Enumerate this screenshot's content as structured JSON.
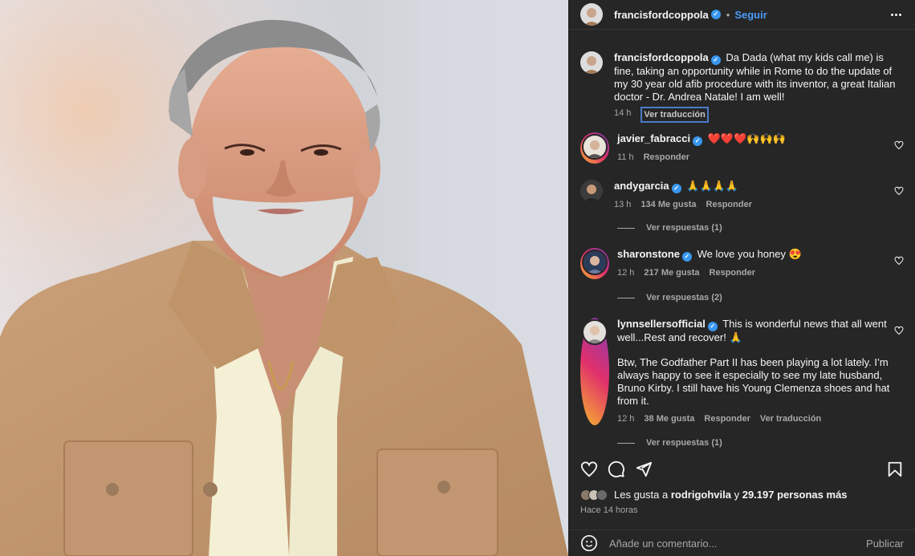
{
  "post": {
    "author": "francisfordcoppola",
    "follow_label": "Seguir",
    "dot": "•",
    "verified_mark": "✓",
    "caption": "Da Dada (what my kids call me) is fine, taking an opportunity while in Rome to do the update of my 30 year old afib procedure with its inventor, a great Italian doctor - Dr. Andrea Natale! I am well!",
    "caption_time": "14 h",
    "translate_label": "Ver traducción"
  },
  "comments": [
    {
      "user": "javier_fabracci",
      "text": "❤️❤️❤️🙌🙌🙌",
      "time": "11 h",
      "likes": "",
      "reply": "Responder",
      "translate": "",
      "view_replies": ""
    },
    {
      "user": "andygarcia",
      "text": "🙏🙏🙏🙏",
      "time": "13 h",
      "likes": "134 Me gusta",
      "reply": "Responder",
      "translate": "",
      "view_replies": "Ver respuestas (1)"
    },
    {
      "user": "sharonstone",
      "text": "We love you honey 😍",
      "time": "12 h",
      "likes": "217 Me gusta",
      "reply": "Responder",
      "translate": "",
      "view_replies": "Ver respuestas (2)"
    },
    {
      "user": "lynnsellersofficial",
      "text": "This is wonderful news that all went well...Rest and recover! 🙏",
      "text2": "Btw, The Godfather Part II has been playing a lot lately. I’m always happy to see it especially to see my late husband, Bruno Kirby. I still have his Young Clemenza shoes and hat from it.",
      "time": "12 h",
      "likes": "38 Me gusta",
      "reply": "Responder",
      "translate": "Ver traducción",
      "view_replies": "Ver respuestas (1)"
    }
  ],
  "footer": {
    "likes_prefix": "Les gusta a",
    "likes_user": "rodrigohvila",
    "likes_mid": "y",
    "likes_count": "29.197 personas más",
    "time_ago": "Hace 14 horas",
    "comment_placeholder": "Añade un comentario...",
    "publish_label": "Publicar"
  },
  "icons": [
    "heart-icon",
    "comment-icon",
    "share-icon",
    "bookmark-icon",
    "emoji-icon",
    "more-icon",
    "verified-icon"
  ],
  "colors": {
    "panel_bg": "#262626",
    "accent": "#4a9bf7",
    "verified": "#3897f0",
    "like_red": "#ff3040"
  }
}
